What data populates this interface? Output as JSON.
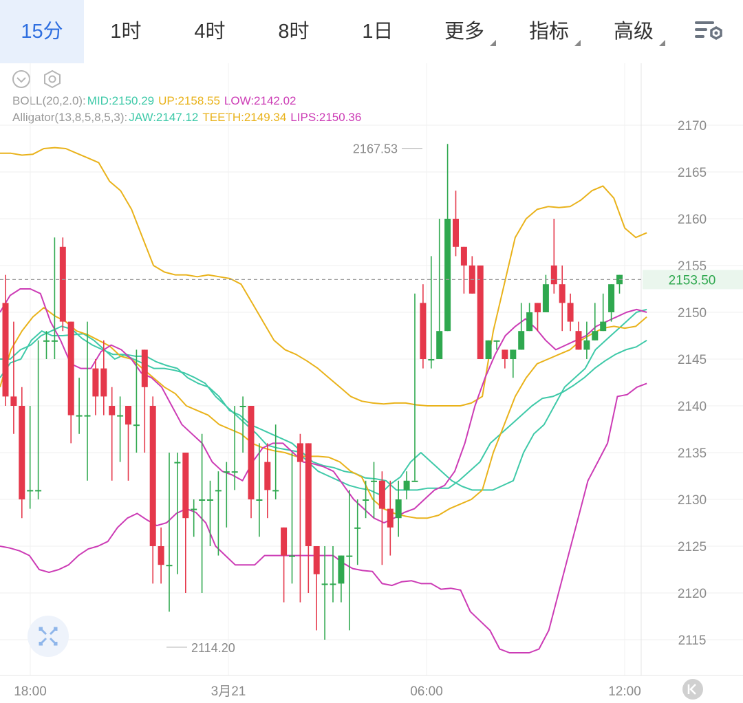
{
  "toolbar": {
    "tabs": [
      {
        "label": "15分",
        "active": true
      },
      {
        "label": "1时"
      },
      {
        "label": "4时"
      },
      {
        "label": "8时"
      },
      {
        "label": "1日"
      },
      {
        "label": "更多",
        "dropdown": true
      },
      {
        "label": "指标",
        "dropdown": true
      },
      {
        "label": "高级",
        "dropdown": true
      }
    ],
    "settings_icon": "chart-settings-icon"
  },
  "legend": {
    "boll": {
      "label": "BOLL(20,2.0):",
      "mid": "MID:2150.29",
      "up": "UP:2158.55",
      "low": "LOW:2142.02"
    },
    "alligator": {
      "label": "Alligator(13,8,5,8,5,3):",
      "jaw": "JAW:2147.12",
      "teeth": "TEETH:2149.34",
      "lips": "LIPS:2150.36"
    }
  },
  "colors": {
    "up": "#2fa84f",
    "down": "#e5384b",
    "mid": "#3ec9a8",
    "upper": "#e9b21a",
    "lower": "#cc3bb5",
    "jaw": "#3ec9a8",
    "teeth": "#e9b21a",
    "lips": "#cc3bb5",
    "price_label": "#2fa84f"
  },
  "chart_data": {
    "type": "candlestick",
    "y_ticks": [
      2170,
      2165,
      2160,
      2155,
      2150,
      2145,
      2140,
      2135,
      2130,
      2125,
      2120,
      2115
    ],
    "x_ticks": [
      "18:00",
      "3月21",
      "06:00",
      "12:00"
    ],
    "ylim": [
      2112.5,
      2172.5
    ],
    "current_price": 2153.5,
    "current_price_label": "2153.50",
    "max_label": "2167.53",
    "min_label": "2114.20",
    "candles": [
      [
        2151,
        2154,
        2141,
        2140
      ],
      [
        2141,
        2149,
        2140,
        2137
      ],
      [
        2140,
        2142,
        2130,
        2128
      ],
      [
        2131,
        2140,
        2131,
        2129
      ],
      [
        2131,
        2147,
        2131,
        2130
      ],
      [
        2147,
        2148,
        2147,
        2145
      ],
      [
        2147,
        2158,
        2147,
        2145
      ],
      [
        2157,
        2158,
        2149,
        2148
      ],
      [
        2149,
        2149,
        2139,
        2136
      ],
      [
        2139,
        2143,
        2139,
        2137
      ],
      [
        2139,
        2149,
        2139,
        2132
      ],
      [
        2144,
        2145,
        2141,
        2139
      ],
      [
        2144,
        2147,
        2141,
        2139
      ],
      [
        2140,
        2142,
        2139,
        2132
      ],
      [
        2139,
        2141,
        2139,
        2134
      ],
      [
        2140,
        2140,
        2138,
        2132
      ],
      [
        2138,
        2146,
        2138,
        2135
      ],
      [
        2146,
        2146,
        2142,
        2135
      ],
      [
        2140,
        2141,
        2125,
        2121
      ],
      [
        2125,
        2127,
        2123,
        2121
      ],
      [
        2123,
        2135,
        2123,
        2118
      ],
      [
        2134,
        2135,
        2134,
        2122
      ],
      [
        2135,
        2135,
        2128,
        2120
      ],
      [
        2129,
        2130,
        2129,
        2126
      ],
      [
        2130,
        2137,
        2130,
        2120
      ],
      [
        2130,
        2132,
        2130,
        2125
      ],
      [
        2131,
        2133,
        2131,
        2124
      ],
      [
        2133,
        2134,
        2133,
        2127
      ],
      [
        2133,
        2140,
        2133,
        2131
      ],
      [
        2140,
        2141,
        2140,
        2135
      ],
      [
        2140,
        2140,
        2130,
        2128
      ],
      [
        2130,
        2136,
        2130,
        2126
      ],
      [
        2134,
        2136,
        2131,
        2128
      ],
      [
        2131,
        2138,
        2131,
        2130
      ],
      [
        2127,
        2127,
        2124,
        2119
      ],
      [
        2124,
        2135,
        2124,
        2121
      ],
      [
        2136,
        2137,
        2134,
        2119
      ],
      [
        2136,
        2136,
        2125,
        2120
      ],
      [
        2125,
        2125,
        2122,
        2116
      ],
      [
        2121,
        2125,
        2121,
        2115
      ],
      [
        2121,
        2125,
        2121,
        2119
      ],
      [
        2121,
        2121,
        2124,
        2119
      ],
      [
        2124,
        2131,
        2124,
        2116
      ],
      [
        2127,
        2130,
        2127,
        2123
      ],
      [
        2130,
        2132,
        2130,
        2128
      ],
      [
        2132,
        2134,
        2132,
        2128
      ],
      [
        2132,
        2133,
        2129,
        2123
      ],
      [
        2129,
        2132,
        2127,
        2124
      ],
      [
        2128,
        2132,
        2130,
        2126
      ],
      [
        2131,
        2133,
        2132,
        2130
      ],
      [
        2132,
        2152,
        2132,
        2133
      ],
      [
        2151,
        2153,
        2145,
        2144
      ],
      [
        2145,
        2156,
        2145,
        2144
      ],
      [
        2145,
        2160,
        2148,
        2147
      ],
      [
        2148,
        2168,
        2160,
        2160
      ],
      [
        2160,
        2163,
        2157,
        2156
      ],
      [
        2157,
        2157,
        2155,
        2152
      ],
      [
        2155,
        2156,
        2152,
        2152
      ],
      [
        2155,
        2155,
        2145,
        2145
      ],
      [
        2145,
        2147,
        2147,
        2145
      ],
      [
        2147,
        2147,
        2147,
        2146
      ],
      [
        2146,
        2146,
        2145,
        2144
      ],
      [
        2145,
        2146,
        2146,
        2143
      ],
      [
        2146,
        2151,
        2148,
        2147
      ],
      [
        2148,
        2151,
        2150,
        2149
      ],
      [
        2151,
        2151,
        2150,
        2148
      ],
      [
        2150,
        2154,
        2153,
        2151
      ],
      [
        2155,
        2160,
        2153,
        2152
      ],
      [
        2153,
        2155,
        2151,
        2148
      ],
      [
        2151,
        2152,
        2149,
        2148
      ],
      [
        2148,
        2149,
        2146,
        2146
      ],
      [
        2146,
        2149,
        2147,
        2145
      ],
      [
        2147,
        2151,
        2148,
        2148
      ],
      [
        2148,
        2152,
        2149,
        2148
      ],
      [
        2150,
        2153,
        2153,
        2149
      ],
      [
        2153,
        2154,
        2154,
        2152
      ]
    ],
    "boll_up": [
      2167,
      2167,
      2166.8,
      2166.9,
      2167.5,
      2167.6,
      2167.5,
      2167,
      2166.5,
      2166,
      2164,
      2163,
      2161,
      2158,
      2155,
      2154.3,
      2154,
      2154,
      2153.8,
      2154,
      2153.8,
      2153.6,
      2153,
      2151,
      2149,
      2147,
      2146,
      2145.5,
      2144.8,
      2144,
      2143,
      2142,
      2141,
      2140.5,
      2140.3,
      2140.2,
      2140.3,
      2140.3,
      2140.1,
      2140,
      2140,
      2140,
      2140,
      2140.3,
      2141,
      2148,
      2153,
      2158,
      2160,
      2161,
      2161.3,
      2161.2,
      2161.3,
      2162,
      2163,
      2163.5,
      2162.2,
      2159,
      2158,
      2158.5
    ],
    "boll_mid": [
      2145,
      2145,
      2146,
      2146.5,
      2147.5,
      2148,
      2148.5,
      2148.2,
      2147.2,
      2146.5,
      2146,
      2145.5,
      2145.5,
      2145,
      2144.5,
      2144,
      2144,
      2143.8,
      2143.5,
      2143,
      2142.4,
      2141,
      2140,
      2139,
      2138,
      2137,
      2135.8,
      2135.5,
      2135.3,
      2135.1,
      2134,
      2133,
      2132.5,
      2132,
      2131.5,
      2131.2,
      2131,
      2130.5,
      2131.6,
      2132.4,
      2134,
      2135,
      2134,
      2133,
      2132,
      2131.4,
      2131,
      2131,
      2131,
      2131.5,
      2132,
      2135,
      2137,
      2138,
      2140,
      2142,
      2143,
      2144,
      2146,
      2147,
      2148,
      2149,
      2150,
      2150.3
    ],
    "boll_low": [
      2125,
      2124.8,
      2124.5,
      2124,
      2122.5,
      2122.2,
      2122.5,
      2123,
      2124,
      2124.7,
      2125,
      2125.5,
      2127,
      2128,
      2128.5,
      2127.8,
      2127.2,
      2127.5,
      2128.5,
      2129,
      2128.6,
      2127.5,
      2125,
      2124,
      2123,
      2123,
      2123,
      2124,
      2124,
      2124,
      2124,
      2124,
      2124,
      2124,
      2124,
      2123.2,
      2122.6,
      2122.4,
      2122.3,
      2121,
      2120.8,
      2121.2,
      2121.3,
      2121,
      2121,
      2120.4,
      2120.5,
      2120.3,
      2118,
      2117,
      2116,
      2114,
      2113.6,
      2113.6,
      2113.6,
      2114,
      2116,
      2120,
      2124,
      2128,
      2132,
      2134,
      2136,
      2141,
      2141.2,
      2142,
      2142.4
    ],
    "jaw": [
      2143,
      2144.6,
      2145,
      2147,
      2148,
      2147.5,
      2147.5,
      2147.6,
      2147.7,
      2147,
      2146,
      2145,
      2145.5,
      2145.3,
      2145.3,
      2144.7,
      2144.3,
      2144,
      2143,
      2142.4,
      2142,
      2141,
      2139.5,
      2139,
      2138,
      2137.5,
      2137,
      2136.5,
      2136,
      2135,
      2134,
      2133.6,
      2133.4,
      2133,
      2132.8,
      2132.3,
      2132.2,
      2132,
      2131,
      2131,
      2131,
      2131.2,
      2131.2,
      2131.2,
      2132,
      2133,
      2134,
      2136,
      2137,
      2138,
      2139,
      2140,
      2140.8,
      2141,
      2141.5,
      2142.2,
      2143,
      2144,
      2144.8,
      2145.5,
      2146,
      2146.3,
      2147
    ],
    "teeth": [
      2142,
      2146,
      2148,
      2149.5,
      2150.5,
      2149.6,
      2149,
      2148,
      2147.6,
      2147,
      2146.4,
      2145.3,
      2145,
      2144,
      2143,
      2142,
      2141.3,
      2140,
      2139.5,
      2139,
      2138,
      2137.5,
      2137,
      2136,
      2135.5,
      2135.2,
      2135,
      2134.6,
      2134.6,
      2134.6,
      2134.5,
      2134,
      2133,
      2132.4,
      2130,
      2129,
      2128.5,
      2128.2,
      2128,
      2128,
      2128.3,
      2129,
      2129.5,
      2130,
      2131,
      2135,
      2138,
      2141,
      2143,
      2144.5,
      2145,
      2145.5,
      2146,
      2147,
      2147.7,
      2148.3,
      2148.5,
      2148.3,
      2148.5,
      2149.5
    ],
    "lips": [
      2150,
      2151.8,
      2152.5,
      2152.5,
      2152,
      2149,
      2147,
      2144.5,
      2144,
      2144,
      2145.8,
      2146.5,
      2146,
      2145,
      2143.5,
      2143,
      2142,
      2140,
      2138,
      2137,
      2136,
      2134,
      2133,
      2132.6,
      2132,
      2134,
      2135.5,
      2136,
      2136,
      2135,
      2134,
      2133.8,
      2133.5,
      2133,
      2131.5,
      2130,
      2129,
      2128,
      2127.5,
      2128,
      2128.6,
      2129,
      2130,
      2131,
      2131.5,
      2133,
      2136,
      2140,
      2143,
      2145.5,
      2147.5,
      2148.5,
      2149.3,
      2148.3,
      2147,
      2146,
      2146.5,
      2147,
      2147.5,
      2148.5,
      2149,
      2149.5,
      2150,
      2150.3,
      2150
    ]
  }
}
